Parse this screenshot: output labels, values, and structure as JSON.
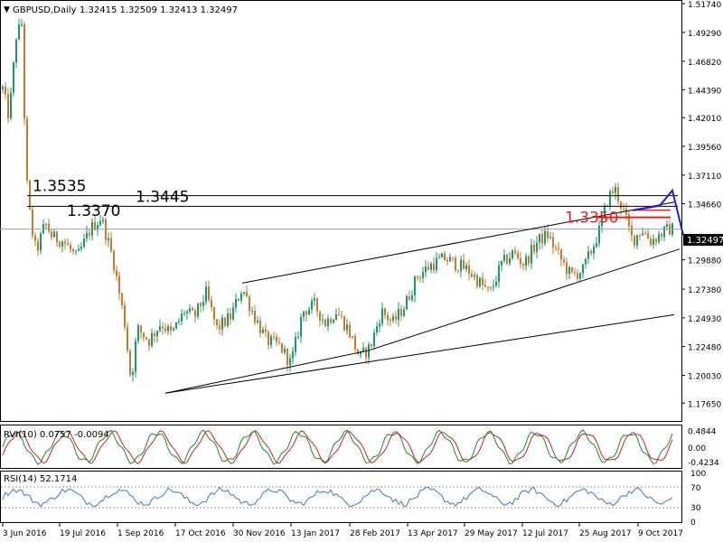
{
  "header": {
    "symbol": "GBPUSD,Daily",
    "ohlc": "1.32415 1.32509 1.32413 1.32497"
  },
  "colors": {
    "bull": "#1a9a6c",
    "bear": "#c97a2a",
    "rvi_main": "#1a8a2a",
    "rvi_signal": "#d02020",
    "rsi": "#3a78c8",
    "red_level": "#e02020",
    "blue_pattern": "#2020d0",
    "grid": "#9aa0a8",
    "price_badge": "#000000"
  },
  "chart_data": [
    {
      "type": "candlestick",
      "title": "GBPUSD,Daily",
      "ylim": [
        1.1675,
        1.5174
      ],
      "y_ticks": [
        "1.51740",
        "1.49290",
        "1.46820",
        "1.44390",
        "1.42010",
        "1.39560",
        "1.37110",
        "1.34660",
        "1.32497",
        "1.29880",
        "1.27380",
        "1.24930",
        "1.22480",
        "1.20030",
        "1.17650"
      ],
      "x_tick_labels": [
        "3 Jun 2016",
        "19 Jul 2016",
        "1 Sep 2016",
        "17 Oct 2016",
        "30 Nov 2016",
        "13 Jan 2017",
        "28 Feb 2017",
        "13 Apr 2017",
        "29 May 2017",
        "12 Jul 2017",
        "25 Aug 2017",
        "9 Oct 2017"
      ],
      "current_price": "1.32497",
      "current_value": 1.32497,
      "close_anchors": [
        [
          0,
          1.455
        ],
        [
          10,
          1.42
        ],
        [
          18,
          1.49
        ],
        [
          24,
          1.5
        ],
        [
          29,
          1.37
        ],
        [
          34,
          1.33
        ],
        [
          40,
          1.305
        ],
        [
          50,
          1.33
        ],
        [
          58,
          1.318
        ],
        [
          70,
          1.315
        ],
        [
          85,
          1.3
        ],
        [
          100,
          1.325
        ],
        [
          112,
          1.335
        ],
        [
          125,
          1.3
        ],
        [
          138,
          1.245
        ],
        [
          145,
          1.195
        ],
        [
          152,
          1.24
        ],
        [
          165,
          1.23
        ],
        [
          178,
          1.245
        ],
        [
          190,
          1.235
        ],
        [
          204,
          1.255
        ],
        [
          215,
          1.25
        ],
        [
          228,
          1.27
        ],
        [
          240,
          1.24
        ],
        [
          255,
          1.25
        ],
        [
          268,
          1.275
        ],
        [
          282,
          1.25
        ],
        [
          295,
          1.23
        ],
        [
          310,
          1.225
        ],
        [
          322,
          1.21
        ],
        [
          335,
          1.255
        ],
        [
          348,
          1.26
        ],
        [
          360,
          1.245
        ],
        [
          372,
          1.255
        ],
        [
          385,
          1.24
        ],
        [
          398,
          1.215
        ],
        [
          410,
          1.225
        ],
        [
          422,
          1.255
        ],
        [
          435,
          1.245
        ],
        [
          448,
          1.26
        ],
        [
          462,
          1.285
        ],
        [
          478,
          1.295
        ],
        [
          492,
          1.3
        ],
        [
          505,
          1.295
        ],
        [
          518,
          1.29
        ],
        [
          530,
          1.28
        ],
        [
          542,
          1.27
        ],
        [
          555,
          1.295
        ],
        [
          568,
          1.305
        ],
        [
          580,
          1.295
        ],
        [
          595,
          1.315
        ],
        [
          606,
          1.32
        ],
        [
          620,
          1.3
        ],
        [
          632,
          1.285
        ],
        [
          645,
          1.29
        ],
        [
          656,
          1.31
        ],
        [
          664,
          1.325
        ],
        [
          672,
          1.35
        ],
        [
          680,
          1.36
        ],
        [
          690,
          1.34
        ],
        [
          700,
          1.315
        ],
        [
          710,
          1.325
        ],
        [
          720,
          1.315
        ],
        [
          730,
          1.32
        ],
        [
          740,
          1.325
        ],
        [
          744,
          1.325
        ]
      ],
      "annotations": [
        {
          "text": "1.3535",
          "value": 1.3535,
          "color": "#000000"
        },
        {
          "text": "1.3370",
          "value": 1.337,
          "color": "#000000"
        },
        {
          "text": "1.3445",
          "value": 1.3445,
          "color": "#000000"
        },
        {
          "text": "1.3350",
          "value": 1.335,
          "color": "#e02020"
        }
      ],
      "horizontal_levels": [
        1.3535,
        1.3445,
        1.32497
      ],
      "trendlines": [
        {
          "from": [
            183,
            1.185
          ],
          "to": [
            408,
            1.2215
          ]
        },
        {
          "from": [
            183,
            1.185
          ],
          "to": [
            746,
            1.252
          ]
        },
        {
          "from": [
            268,
            1.279
          ],
          "to": [
            746,
            1.348
          ]
        },
        {
          "from": [
            408,
            1.2215
          ],
          "to": [
            752,
            1.308
          ]
        }
      ]
    },
    {
      "type": "line",
      "title": "RVI(10) 0.0757 -0.0094",
      "ylim": [
        -0.55,
        0.6
      ],
      "y_ticks": [
        "0.4844",
        "0.00",
        "-0.4234"
      ],
      "series": [
        {
          "name": "RVI main",
          "values": []
        },
        {
          "name": "RVI signal",
          "values": []
        }
      ]
    },
    {
      "type": "line",
      "title": "RSI(14) 52.1714",
      "ylim": [
        0,
        100
      ],
      "y_ticks": [
        "100",
        "70",
        "30",
        "0"
      ],
      "series": [
        {
          "name": "RSI",
          "values": []
        }
      ]
    }
  ]
}
